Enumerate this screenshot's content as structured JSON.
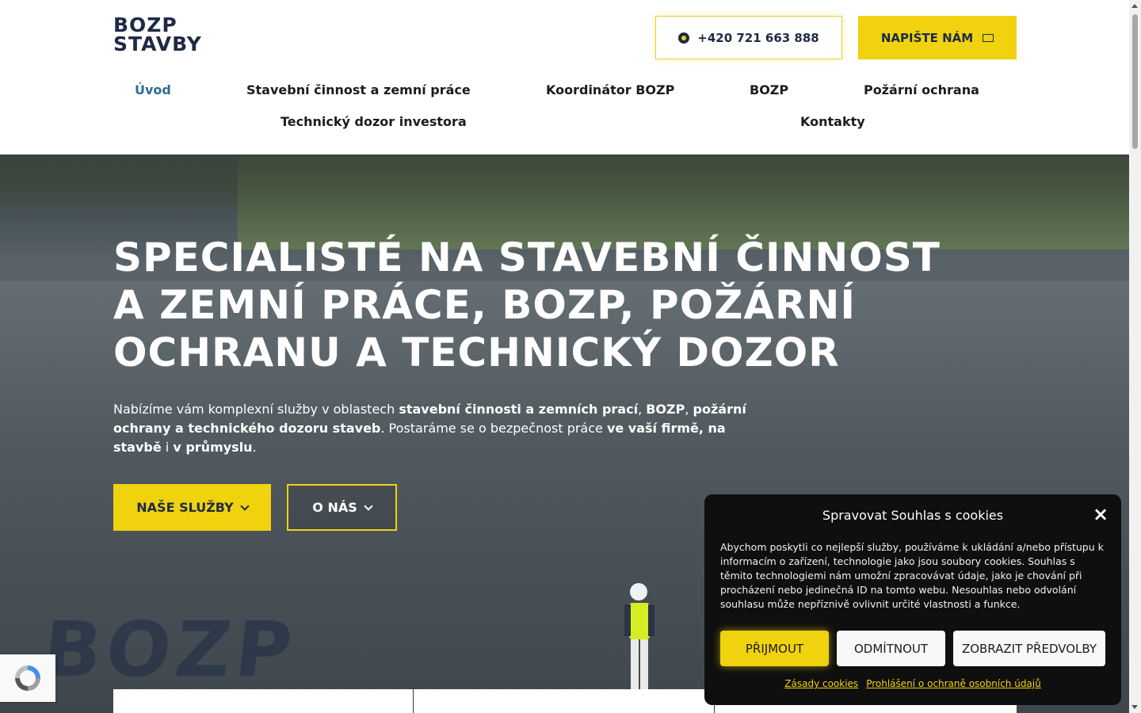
{
  "header": {
    "logo": {
      "line1": "BOZP",
      "line2": "STAVBY"
    },
    "phone_button": "+420 721 663 888",
    "mail_button": "NAPIŠTE NÁM",
    "nav": [
      {
        "label": "Úvod",
        "active": true
      },
      {
        "label": "Stavební činnost a zemní práce"
      },
      {
        "label": "Koordinátor BOZP"
      },
      {
        "label": "BOZP"
      },
      {
        "label": "Požární ochrana"
      },
      {
        "label": "Technický dozor investora"
      },
      {
        "label": "Kontakty"
      }
    ]
  },
  "hero": {
    "title": "SPECIALISTÉ NA STAVEBNÍ ČINNOST A ZEMNÍ PRÁCE, BOZP, POŽÁRNÍ OCHRANU A TECHNICKÝ DOZOR",
    "desc": {
      "p1": "Nabízíme vám komplexní služby v oblastech ",
      "b1": "stavební činnosti a zemních prací",
      "p2": ", ",
      "b2": "BOZP",
      "p3": ", ",
      "b3": "požární ochrany a technického dozoru staveb",
      "p4": ". Postaráme se o bezpečnost práce ",
      "b4": "ve vaší firmě, na stavbě",
      "p5": " i ",
      "b5": "v průmyslu",
      "p6": "."
    },
    "services_button": "NAŠE SLUŽBY",
    "about_button": "O NÁS",
    "ghost_logo": "BOZP"
  },
  "cookie": {
    "title": "Spravovat Souhlas s cookies",
    "text": "Abychom poskytli co nejlepší služby, používáme k ukládání a/nebo přístupu k informacím o zařízení, technologie jako jsou soubory cookies. Souhlas s těmito technologiemi nám umožní zpracovávat údaje, jako je chování při procházení nebo jedinečná ID na tomto webu. Nesouhlas nebo odvolání souhlasu může nepříznivě ovlivnit určité vlastnosti a funkce.",
    "accept": "PŘIJMOUT",
    "deny": "ODMÍTNOUT",
    "prefs": "ZOBRAZIT PŘEDVOLBY",
    "link1": "Zásady cookies",
    "link2": "Prohlášení o ochraně osobních údajů"
  },
  "colors": {
    "accent": "#f0d20f",
    "navy": "#1f2a44",
    "active_nav": "#2b6e8f"
  }
}
